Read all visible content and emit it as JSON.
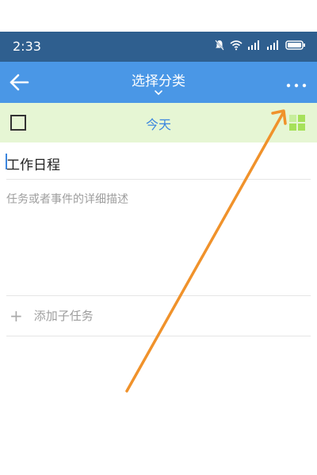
{
  "status_bar": {
    "time": "2:33",
    "signal_text": "5G"
  },
  "app_bar": {
    "back_icon": "arrow-left-icon",
    "title": "选择分类",
    "title_chevron": "chevron-down-icon",
    "more_icon": "more-horizontal-icon"
  },
  "date_row": {
    "checkbox_checked": false,
    "date_label": "今天",
    "priority_icon": "quadrant-grid-icon",
    "priority_color": "#a6e15a"
  },
  "task": {
    "title": "工作日程",
    "description_placeholder": "任务或者事件的详细描述",
    "add_subtask_label": "添加子任务",
    "add_icon": "plus-icon"
  },
  "colors": {
    "status_bar": "#2f5f8f",
    "app_bar": "#4a97e6",
    "date_row_bg": "#e6f6d4",
    "accent": "#3b86df",
    "annotation_arrow": "#f0922b"
  }
}
